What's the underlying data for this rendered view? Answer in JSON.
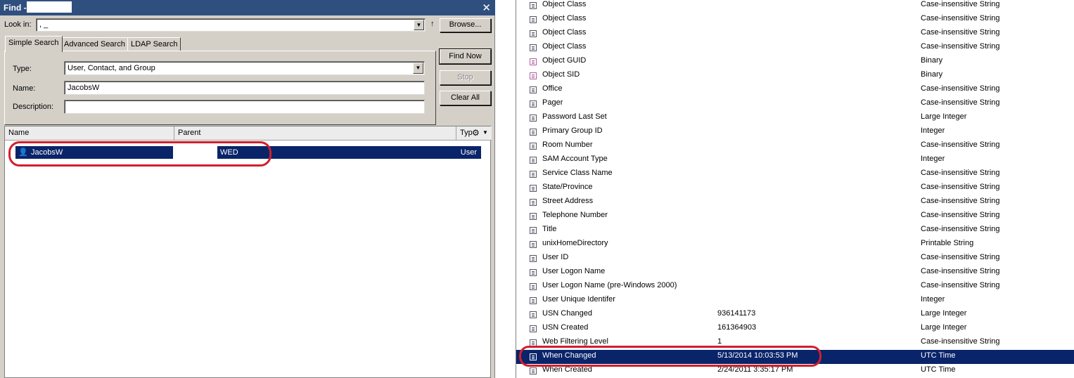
{
  "find": {
    "title": "Find -",
    "look_in_label": "Look in:",
    "look_in_value": ", _",
    "browse_label": "Browse...",
    "tabs": [
      "Simple Search",
      "Advanced Search",
      "LDAP Search"
    ],
    "type_label": "Type:",
    "type_value": "User, Contact, and Group",
    "name_label": "Name:",
    "name_value": "JacobsW",
    "description_label": "Description:",
    "description_value": "",
    "find_now": "Find Now",
    "stop": "Stop",
    "clear_all": "Clear All",
    "columns": [
      "Name",
      "Parent",
      "Typ"
    ],
    "result": {
      "name": "JacobsW",
      "parent": "WED",
      "type": "User"
    }
  },
  "attributes": [
    {
      "name": "Object Class",
      "value": "",
      "syntax": "Case-insensitive String",
      "icon": "string-icon"
    },
    {
      "name": "Object Class",
      "value": "",
      "syntax": "Case-insensitive String",
      "icon": "string-icon"
    },
    {
      "name": "Object Class",
      "value": "",
      "syntax": "Case-insensitive String",
      "icon": "string-icon"
    },
    {
      "name": "Object Class",
      "value": "",
      "syntax": "Case-insensitive String",
      "icon": "string-icon"
    },
    {
      "name": "Object GUID",
      "value": "",
      "syntax": "Binary",
      "icon": "binary-icon"
    },
    {
      "name": "Object SID",
      "value": "",
      "syntax": "Binary",
      "icon": "binary-icon"
    },
    {
      "name": "Office",
      "value": "",
      "syntax": "Case-insensitive String",
      "icon": "string-icon"
    },
    {
      "name": "Pager",
      "value": "",
      "syntax": "Case-insensitive String",
      "icon": "string-icon"
    },
    {
      "name": "Password Last Set",
      "value": "",
      "syntax": "Large Integer",
      "icon": "string-icon"
    },
    {
      "name": "Primary Group ID",
      "value": "",
      "syntax": "Integer",
      "icon": "string-icon"
    },
    {
      "name": "Room Number",
      "value": "",
      "syntax": "Case-insensitive String",
      "icon": "string-icon"
    },
    {
      "name": "SAM Account Type",
      "value": "",
      "syntax": "Integer",
      "icon": "string-icon"
    },
    {
      "name": "Service Class Name",
      "value": "",
      "syntax": "Case-insensitive String",
      "icon": "string-icon"
    },
    {
      "name": "State/Province",
      "value": "",
      "syntax": "Case-insensitive String",
      "icon": "string-icon"
    },
    {
      "name": "Street Address",
      "value": "",
      "syntax": "Case-insensitive String",
      "icon": "string-icon"
    },
    {
      "name": "Telephone Number",
      "value": "",
      "syntax": "Case-insensitive String",
      "icon": "string-icon"
    },
    {
      "name": "Title",
      "value": "",
      "syntax": "Case-insensitive String",
      "icon": "string-icon"
    },
    {
      "name": "unixHomeDirectory",
      "value": "",
      "syntax": "Printable String",
      "icon": "string-icon"
    },
    {
      "name": "User ID",
      "value": "",
      "syntax": "Case-insensitive String",
      "icon": "string-icon"
    },
    {
      "name": "User Logon Name",
      "value": "",
      "syntax": "Case-insensitive String",
      "icon": "string-icon"
    },
    {
      "name": "User Logon Name (pre-Windows 2000)",
      "value": "",
      "syntax": "Case-insensitive String",
      "icon": "string-icon"
    },
    {
      "name": "User Unique Identifer",
      "value": "",
      "syntax": "Integer",
      "icon": "string-icon"
    },
    {
      "name": "USN Changed",
      "value": "936141173",
      "syntax": "Large Integer",
      "icon": "string-icon"
    },
    {
      "name": "USN Created",
      "value": "161364903",
      "syntax": "Large Integer",
      "icon": "string-icon"
    },
    {
      "name": "Web Filtering Level",
      "value": "1",
      "syntax": "Case-insensitive String",
      "icon": "string-icon"
    },
    {
      "name": "When Changed",
      "value": "5/13/2014 10:03:53 PM",
      "syntax": "UTC Time",
      "icon": "string-icon",
      "selected": true
    },
    {
      "name": "When Created",
      "value": "2/24/2011 3:35:17 PM",
      "syntax": "UTC Time",
      "icon": "string-icon"
    }
  ],
  "colors": {
    "selection": "#0a246a",
    "highlight_ring": "#d21f2b",
    "titlebar": "#2f4f7f"
  }
}
